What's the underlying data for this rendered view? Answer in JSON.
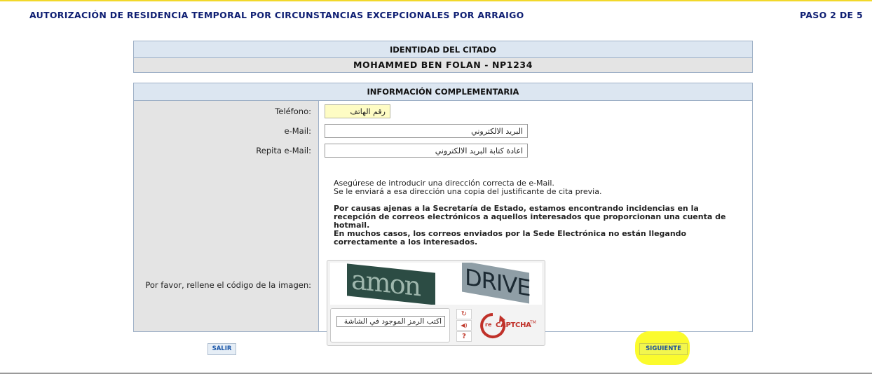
{
  "header": {
    "title": "AUTORIZACIÓN DE RESIDENCIA TEMPORAL POR CIRCUNSTANCIAS EXCEPCIONALES POR ARRAIGO",
    "step": "PASO 2 DE 5"
  },
  "identity": {
    "heading": "IDENTIDAD DEL CITADO",
    "name": "MOHAMMED BEN FOLAN - NP1234"
  },
  "info": {
    "heading": "INFORMACIÓN COMPLEMENTARIA",
    "phone_label": "Teléfono:",
    "phone_value": "رقم الهاتف",
    "email_label": "e-Mail:",
    "email_value": "البريد الالكتروني",
    "email_repeat_label": "Repita e-Mail:",
    "email_repeat_value": "اعادة كتابة البريد الالكتروني",
    "note_line1": "Asegúrese de introducir una dirección correcta de e-Mail.",
    "note_line2": "Se le enviará a esa dirección una copia del justificante de cita previa.",
    "warning_line1": "Por causas ajenas a la Secretaría de Estado, estamos encontrando incidencias en la",
    "warning_line2": "recepción de correos electrónicos a aquellos interesados que proporcionan una cuenta de",
    "warning_line3": "hotmail.",
    "warning_line4": "En muchos casos, los correos enviados por la Sede Electrónica no están llegando",
    "warning_line5": "correctamente a los interesados.",
    "captcha_label": "Por favor, rellene el código de la imagen:"
  },
  "captcha": {
    "word1": "amon",
    "word2": "DRIVE",
    "input_value": "اكتب الرمز الموجود في الشاشة",
    "brand_prefix": "re",
    "brand": "CAPTCHA",
    "trademark": "TM",
    "refresh_glyph": "↻",
    "audio_glyph": "◀)",
    "help_glyph": "?"
  },
  "buttons": {
    "exit": "SALIR",
    "next": "SIGUIENTE"
  },
  "colors": {
    "title_blue": "#0f1f73",
    "header_bg": "#dce6f1",
    "label_bg": "#e4e4e4",
    "highlight": "#fbfb2d",
    "recaptcha_red": "#c03129"
  }
}
